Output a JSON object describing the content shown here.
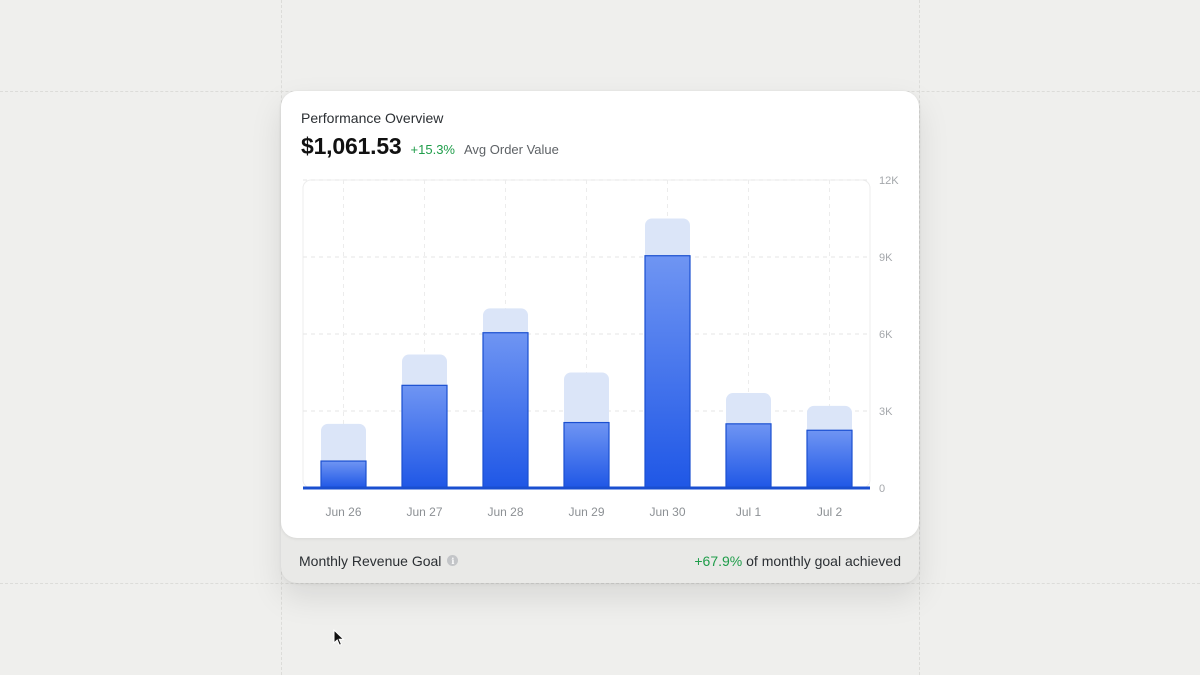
{
  "card": {
    "title": "Performance Overview",
    "metric_value": "$1,061.53",
    "metric_delta": "+15.3%",
    "metric_label": "Avg Order Value"
  },
  "footer": {
    "goal_label": "Monthly Revenue Goal",
    "info_icon": "info-icon",
    "achieved_pct": "+67.9%",
    "achieved_text": "of monthly goal achieved"
  },
  "colors": {
    "bar_top": "#6f95f3",
    "bar_bottom": "#1f57e6",
    "bar_stroke": "#1a4fd0",
    "bar_background": "#dbe5f8",
    "positive": "#1f9d4a"
  },
  "chart_data": {
    "type": "bar",
    "categories": [
      "Jun 26",
      "Jun 27",
      "Jun 28",
      "Jun 29",
      "Jun 30",
      "Jul 1",
      "Jul 2"
    ],
    "series": [
      {
        "values": [
          2500,
          5200,
          7000,
          4500,
          10500,
          3700,
          3200
        ]
      },
      {
        "values": [
          1050,
          4000,
          6050,
          2550,
          9050,
          2500,
          2250
        ]
      }
    ],
    "y_ticks": [
      "12K",
      "9K",
      "6K",
      "3K",
      "0"
    ],
    "y_tick_values": [
      12000,
      9000,
      6000,
      3000,
      0
    ],
    "ylim": [
      0,
      12000
    ],
    "grid": true,
    "y_axis_position": "right",
    "legend": "none"
  }
}
